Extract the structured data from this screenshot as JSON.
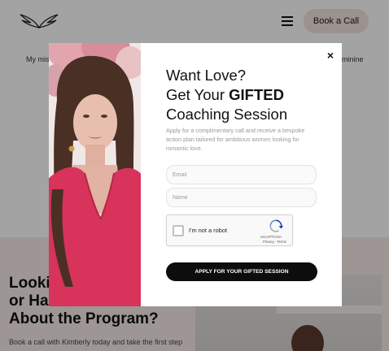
{
  "background": {
    "header": {
      "book_call_label": "Book a Call"
    },
    "intro": {
      "left_text": "My mis",
      "right_text": "minine"
    },
    "lower": {
      "heading_line1": "Looki",
      "heading_line2": "or Ha",
      "heading_line3": "About the Program?",
      "text": "Book a call with Kimberly today and take the first step"
    }
  },
  "modal": {
    "close_label": "×",
    "headline": {
      "line1": "Want Love?",
      "line2_prefix": "Get Your ",
      "line2_bold": "GIFTED",
      "line3": "Coaching Session"
    },
    "subtext": "Apply for a complimentary call and receive a bespoke action plan tailored for ambitious women looking for romantic love.",
    "form": {
      "email_placeholder": "Email",
      "name_placeholder": "Name",
      "recaptcha_label": "I'm not a robot",
      "recaptcha_brand": "reCAPTCHA",
      "recaptcha_links": "Privacy - Terms",
      "submit_label": "APPLY FOR YOUR GIFTED SESSION"
    }
  },
  "colors": {
    "overlay": "#000000",
    "button": "#0d0d0d",
    "book_call_bg": "#f2e3df",
    "peach_band": "#f6ebe8",
    "dress": "#d8335a"
  },
  "icons": {
    "logo": "wings-logo-icon",
    "menu": "hamburger-menu-icon",
    "close": "close-icon",
    "recaptcha": "recaptcha-logo-icon"
  }
}
